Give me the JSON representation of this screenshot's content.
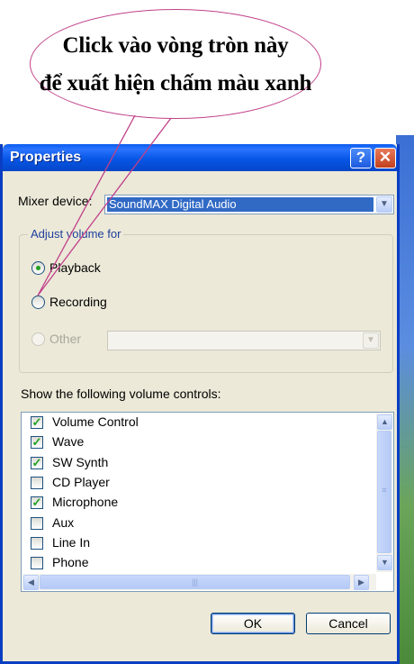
{
  "callout": {
    "line1": "Click vào vòng tròn này",
    "line2": "để xuất hiện chấm màu xanh",
    "border_color": "#c0408a"
  },
  "window": {
    "title": "Properties",
    "help_label": "?",
    "close_label": "✕"
  },
  "mixer": {
    "label": "Mixer device:",
    "value": "SoundMAX Digital Audio"
  },
  "adjust": {
    "title": "Adjust volume for",
    "options": [
      {
        "label": "Playback",
        "selected": true,
        "enabled": true
      },
      {
        "label": "Recording",
        "selected": false,
        "enabled": true
      },
      {
        "label": "Other",
        "selected": false,
        "enabled": false
      }
    ]
  },
  "controls": {
    "label": "Show the following volume controls:",
    "items": [
      {
        "label": "Volume Control",
        "checked": true
      },
      {
        "label": "Wave",
        "checked": true
      },
      {
        "label": "SW Synth",
        "checked": true
      },
      {
        "label": "CD Player",
        "checked": false
      },
      {
        "label": "Microphone",
        "checked": true
      },
      {
        "label": "Aux",
        "checked": false
      },
      {
        "label": "Line In",
        "checked": false
      },
      {
        "label": "Phone",
        "checked": false
      }
    ]
  },
  "buttons": {
    "ok": "OK",
    "cancel": "Cancel"
  },
  "colors": {
    "title_blue": "#0856e6",
    "check_green": "#21a121",
    "selection_blue": "#316ac5"
  }
}
